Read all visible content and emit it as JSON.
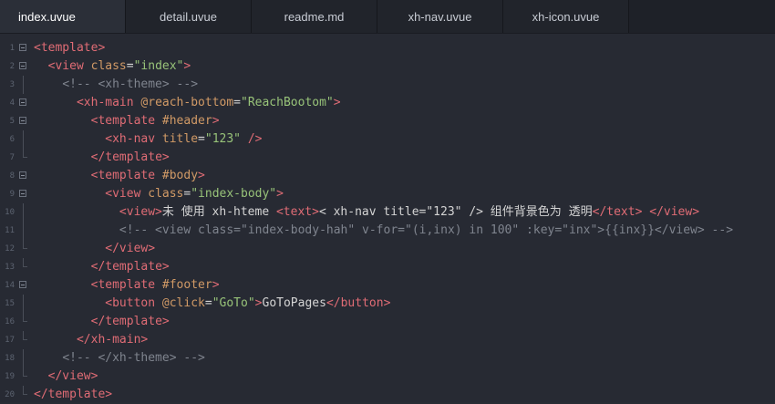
{
  "tabs": [
    {
      "label": "index.uvue",
      "active": true
    },
    {
      "label": "detail.uvue",
      "active": false
    },
    {
      "label": "readme.md",
      "active": false
    },
    {
      "label": "xh-nav.uvue",
      "active": false
    },
    {
      "label": "xh-icon.uvue",
      "active": false
    }
  ],
  "colors": {
    "background": "#272a33",
    "tag": "#e06c75",
    "attribute": "#d19a66",
    "string": "#98c379",
    "comment": "#7f848e",
    "text": "#d4d4d4"
  },
  "lines": [
    {
      "n": "1",
      "tokens": [
        [
          "tag",
          "<template"
        ],
        [
          "tag",
          ">"
        ]
      ]
    },
    {
      "n": "2",
      "tokens": [
        [
          "plain",
          "  "
        ],
        [
          "tag",
          "<view"
        ],
        [
          "plain",
          " "
        ],
        [
          "attr",
          "class"
        ],
        [
          "plain",
          "="
        ],
        [
          "str",
          "\"index\""
        ],
        [
          "tag",
          ">"
        ]
      ]
    },
    {
      "n": "3",
      "tokens": [
        [
          "plain",
          "    "
        ],
        [
          "cmt",
          "<!-- <xh-theme> -->"
        ]
      ]
    },
    {
      "n": "4",
      "tokens": [
        [
          "plain",
          "      "
        ],
        [
          "tag",
          "<xh-main"
        ],
        [
          "plain",
          " "
        ],
        [
          "attr",
          "@reach-bottom"
        ],
        [
          "plain",
          "="
        ],
        [
          "str",
          "\"ReachBootom\""
        ],
        [
          "tag",
          ">"
        ]
      ]
    },
    {
      "n": "5",
      "tokens": [
        [
          "plain",
          "        "
        ],
        [
          "tag",
          "<template"
        ],
        [
          "plain",
          " "
        ],
        [
          "attr",
          "#header"
        ],
        [
          "tag",
          ">"
        ]
      ]
    },
    {
      "n": "6",
      "tokens": [
        [
          "plain",
          "          "
        ],
        [
          "tag",
          "<xh-nav"
        ],
        [
          "plain",
          " "
        ],
        [
          "attr",
          "title"
        ],
        [
          "plain",
          "="
        ],
        [
          "str",
          "\"123\""
        ],
        [
          "plain",
          " "
        ],
        [
          "tag",
          "/>"
        ]
      ]
    },
    {
      "n": "7",
      "tokens": [
        [
          "plain",
          "        "
        ],
        [
          "tag",
          "</template>"
        ]
      ]
    },
    {
      "n": "8",
      "tokens": [
        [
          "plain",
          "        "
        ],
        [
          "tag",
          "<template"
        ],
        [
          "plain",
          " "
        ],
        [
          "attr",
          "#body"
        ],
        [
          "tag",
          ">"
        ]
      ]
    },
    {
      "n": "9",
      "tokens": [
        [
          "plain",
          "          "
        ],
        [
          "tag",
          "<view"
        ],
        [
          "plain",
          " "
        ],
        [
          "attr",
          "class"
        ],
        [
          "plain",
          "="
        ],
        [
          "str",
          "\"index-body\""
        ],
        [
          "tag",
          ">"
        ]
      ]
    },
    {
      "n": "10",
      "tokens": [
        [
          "plain",
          "            "
        ],
        [
          "tag",
          "<view>"
        ],
        [
          "plain",
          "未 使用 xh-hteme "
        ],
        [
          "tag",
          "<text>"
        ],
        [
          "plain",
          "< xh-nav title=\"123\" /> 组件背景色为 透明"
        ],
        [
          "tag",
          "</text>"
        ],
        [
          "plain",
          " "
        ],
        [
          "tag",
          "</view>"
        ]
      ]
    },
    {
      "n": "11",
      "tokens": [
        [
          "plain",
          "            "
        ],
        [
          "cmt",
          "<!-- <view class=\"index-body-hah\" v-for=\"(i,inx) in 100\" :key=\"inx\">{{inx}}</view> -->"
        ]
      ]
    },
    {
      "n": "12",
      "tokens": [
        [
          "plain",
          "          "
        ],
        [
          "tag",
          "</view>"
        ]
      ]
    },
    {
      "n": "13",
      "tokens": [
        [
          "plain",
          "        "
        ],
        [
          "tag",
          "</template>"
        ]
      ]
    },
    {
      "n": "14",
      "tokens": [
        [
          "plain",
          "        "
        ],
        [
          "tag",
          "<template"
        ],
        [
          "plain",
          " "
        ],
        [
          "attr",
          "#footer"
        ],
        [
          "tag",
          ">"
        ]
      ]
    },
    {
      "n": "15",
      "tokens": [
        [
          "plain",
          "          "
        ],
        [
          "tag",
          "<button"
        ],
        [
          "plain",
          " "
        ],
        [
          "attr",
          "@click"
        ],
        [
          "plain",
          "="
        ],
        [
          "str",
          "\"GoTo\""
        ],
        [
          "tag",
          ">"
        ],
        [
          "plain",
          "GoToPages"
        ],
        [
          "tag",
          "</button>"
        ]
      ]
    },
    {
      "n": "16",
      "tokens": [
        [
          "plain",
          "        "
        ],
        [
          "tag",
          "</template>"
        ]
      ]
    },
    {
      "n": "17",
      "tokens": [
        [
          "plain",
          "      "
        ],
        [
          "tag",
          "</xh-main>"
        ]
      ]
    },
    {
      "n": "18",
      "tokens": [
        [
          "plain",
          "    "
        ],
        [
          "cmt",
          "<!-- </xh-theme> -->"
        ]
      ]
    },
    {
      "n": "19",
      "tokens": [
        [
          "plain",
          "  "
        ],
        [
          "tag",
          "</view>"
        ]
      ]
    },
    {
      "n": "20",
      "tokens": [
        [
          "tag",
          "</template>"
        ]
      ]
    }
  ]
}
